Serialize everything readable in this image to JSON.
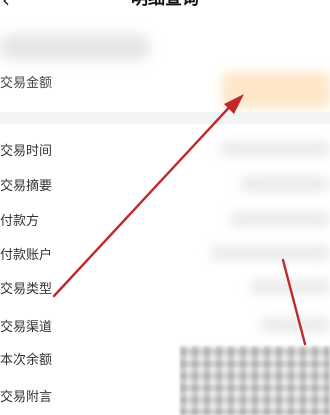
{
  "nav": {
    "back_icon": "chevron-left-icon",
    "title": "明细查询"
  },
  "summary": {
    "amount_label": "交易金额"
  },
  "details": {
    "rows": [
      {
        "label": "交易时间"
      },
      {
        "label": "交易摘要"
      },
      {
        "label": "付款方"
      },
      {
        "label": "付款账户"
      },
      {
        "label": "交易类型"
      },
      {
        "label": "交易渠道"
      },
      {
        "label": "本次余额"
      },
      {
        "label": "交易附言"
      }
    ]
  },
  "annotation": {
    "arrow_color": "#c0282e"
  }
}
